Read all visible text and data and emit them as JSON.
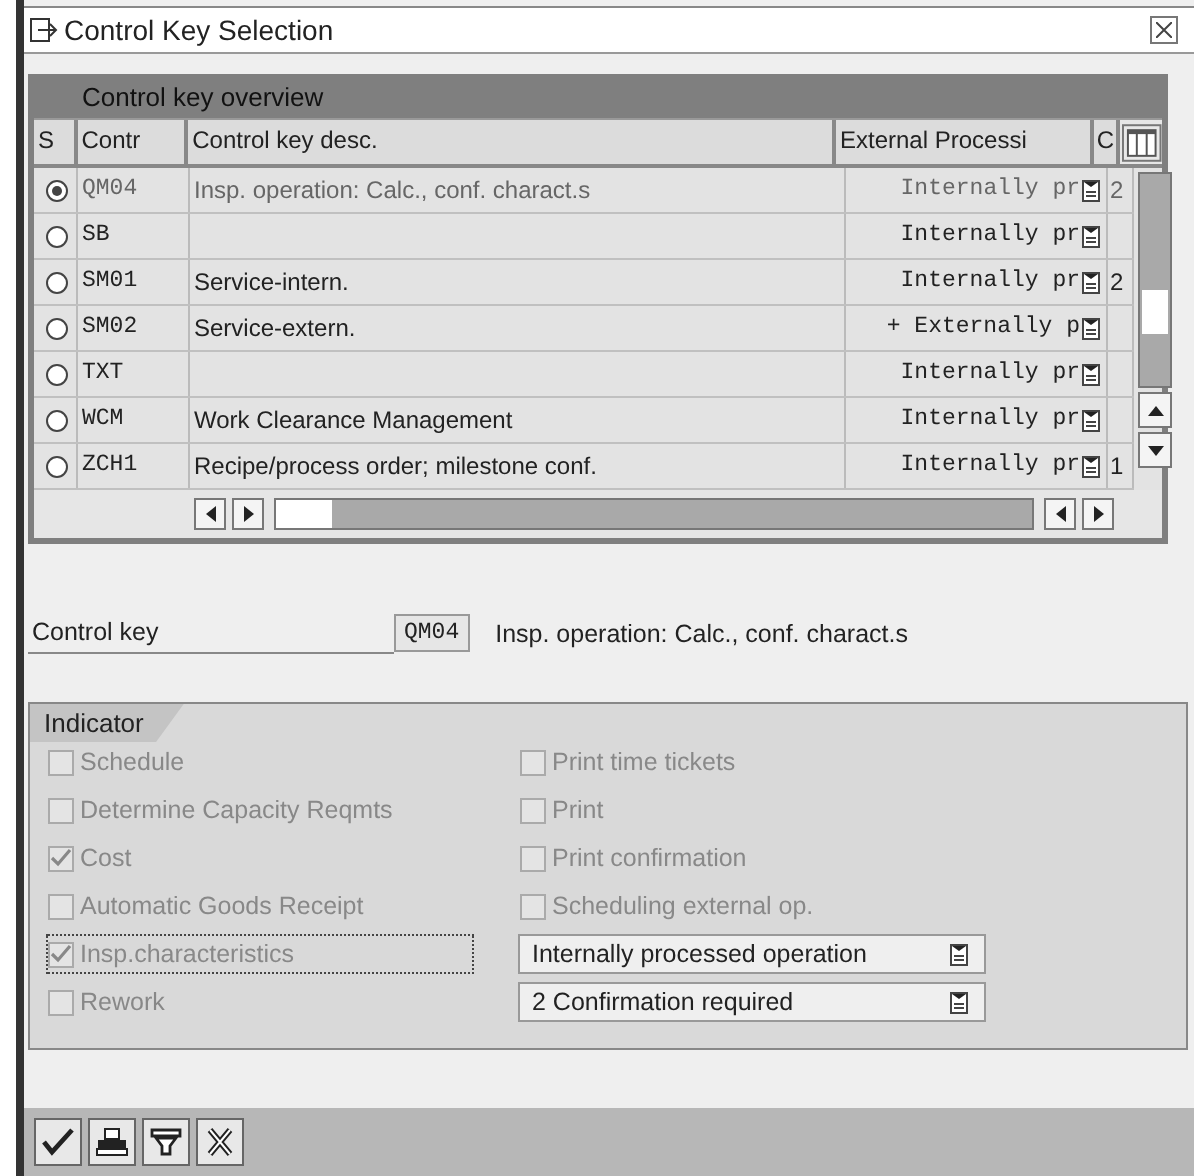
{
  "window": {
    "title": "Control Key Selection"
  },
  "table": {
    "title": "Control key overview",
    "columns": [
      "S",
      "Contr",
      "Control key desc.",
      "External Processi",
      "C"
    ],
    "rows": [
      {
        "selected": true,
        "code": "QM04",
        "description": "Insp. operation: Calc., conf. charact.s",
        "external": "Internally pr",
        "c": "2"
      },
      {
        "selected": false,
        "code": "SB",
        "description": "",
        "external": "Internally pr",
        "c": ""
      },
      {
        "selected": false,
        "code": "SM01",
        "description": "Service-intern.",
        "external": "Internally pr",
        "c": "2"
      },
      {
        "selected": false,
        "code": "SM02",
        "description": "Service-extern.",
        "external": "+ Externally p",
        "c": ""
      },
      {
        "selected": false,
        "code": "TXT",
        "description": "",
        "external": "Internally pr",
        "c": ""
      },
      {
        "selected": false,
        "code": "WCM",
        "description": "Work Clearance Management",
        "external": "Internally pr",
        "c": ""
      },
      {
        "selected": false,
        "code": "ZCH1",
        "description": "Recipe/process order; milestone conf.",
        "external": "Internally pr",
        "c": "1"
      }
    ]
  },
  "control_key": {
    "label": "Control key",
    "value": "QM04",
    "description": "Insp. operation: Calc., conf. charact.s"
  },
  "indicator": {
    "title": "Indicator",
    "left": [
      {
        "label": "Schedule",
        "checked": false,
        "disabled": true,
        "focused": false
      },
      {
        "label": "Determine Capacity Reqmts",
        "checked": false,
        "disabled": true,
        "focused": false
      },
      {
        "label": "Cost",
        "checked": true,
        "disabled": true,
        "focused": false
      },
      {
        "label": "Automatic Goods Receipt",
        "checked": false,
        "disabled": true,
        "focused": false
      },
      {
        "label": "Insp.characteristics",
        "checked": true,
        "disabled": true,
        "focused": true
      },
      {
        "label": "Rework",
        "checked": false,
        "disabled": true,
        "focused": false
      }
    ],
    "right": [
      {
        "kind": "checkbox",
        "label": "Print time tickets",
        "checked": false,
        "disabled": true
      },
      {
        "kind": "checkbox",
        "label": "Print",
        "checked": false,
        "disabled": true
      },
      {
        "kind": "checkbox",
        "label": "Print confirmation",
        "checked": false,
        "disabled": true
      },
      {
        "kind": "checkbox",
        "label": "Scheduling external op.",
        "checked": false,
        "disabled": true
      },
      {
        "kind": "dropdown",
        "value": "Internally processed operation"
      },
      {
        "kind": "dropdown",
        "value": "2 Confirmation required"
      }
    ]
  },
  "toolbar": [
    {
      "kind": "confirm"
    },
    {
      "kind": "print"
    },
    {
      "kind": "filter"
    },
    {
      "kind": "cancel"
    }
  ]
}
